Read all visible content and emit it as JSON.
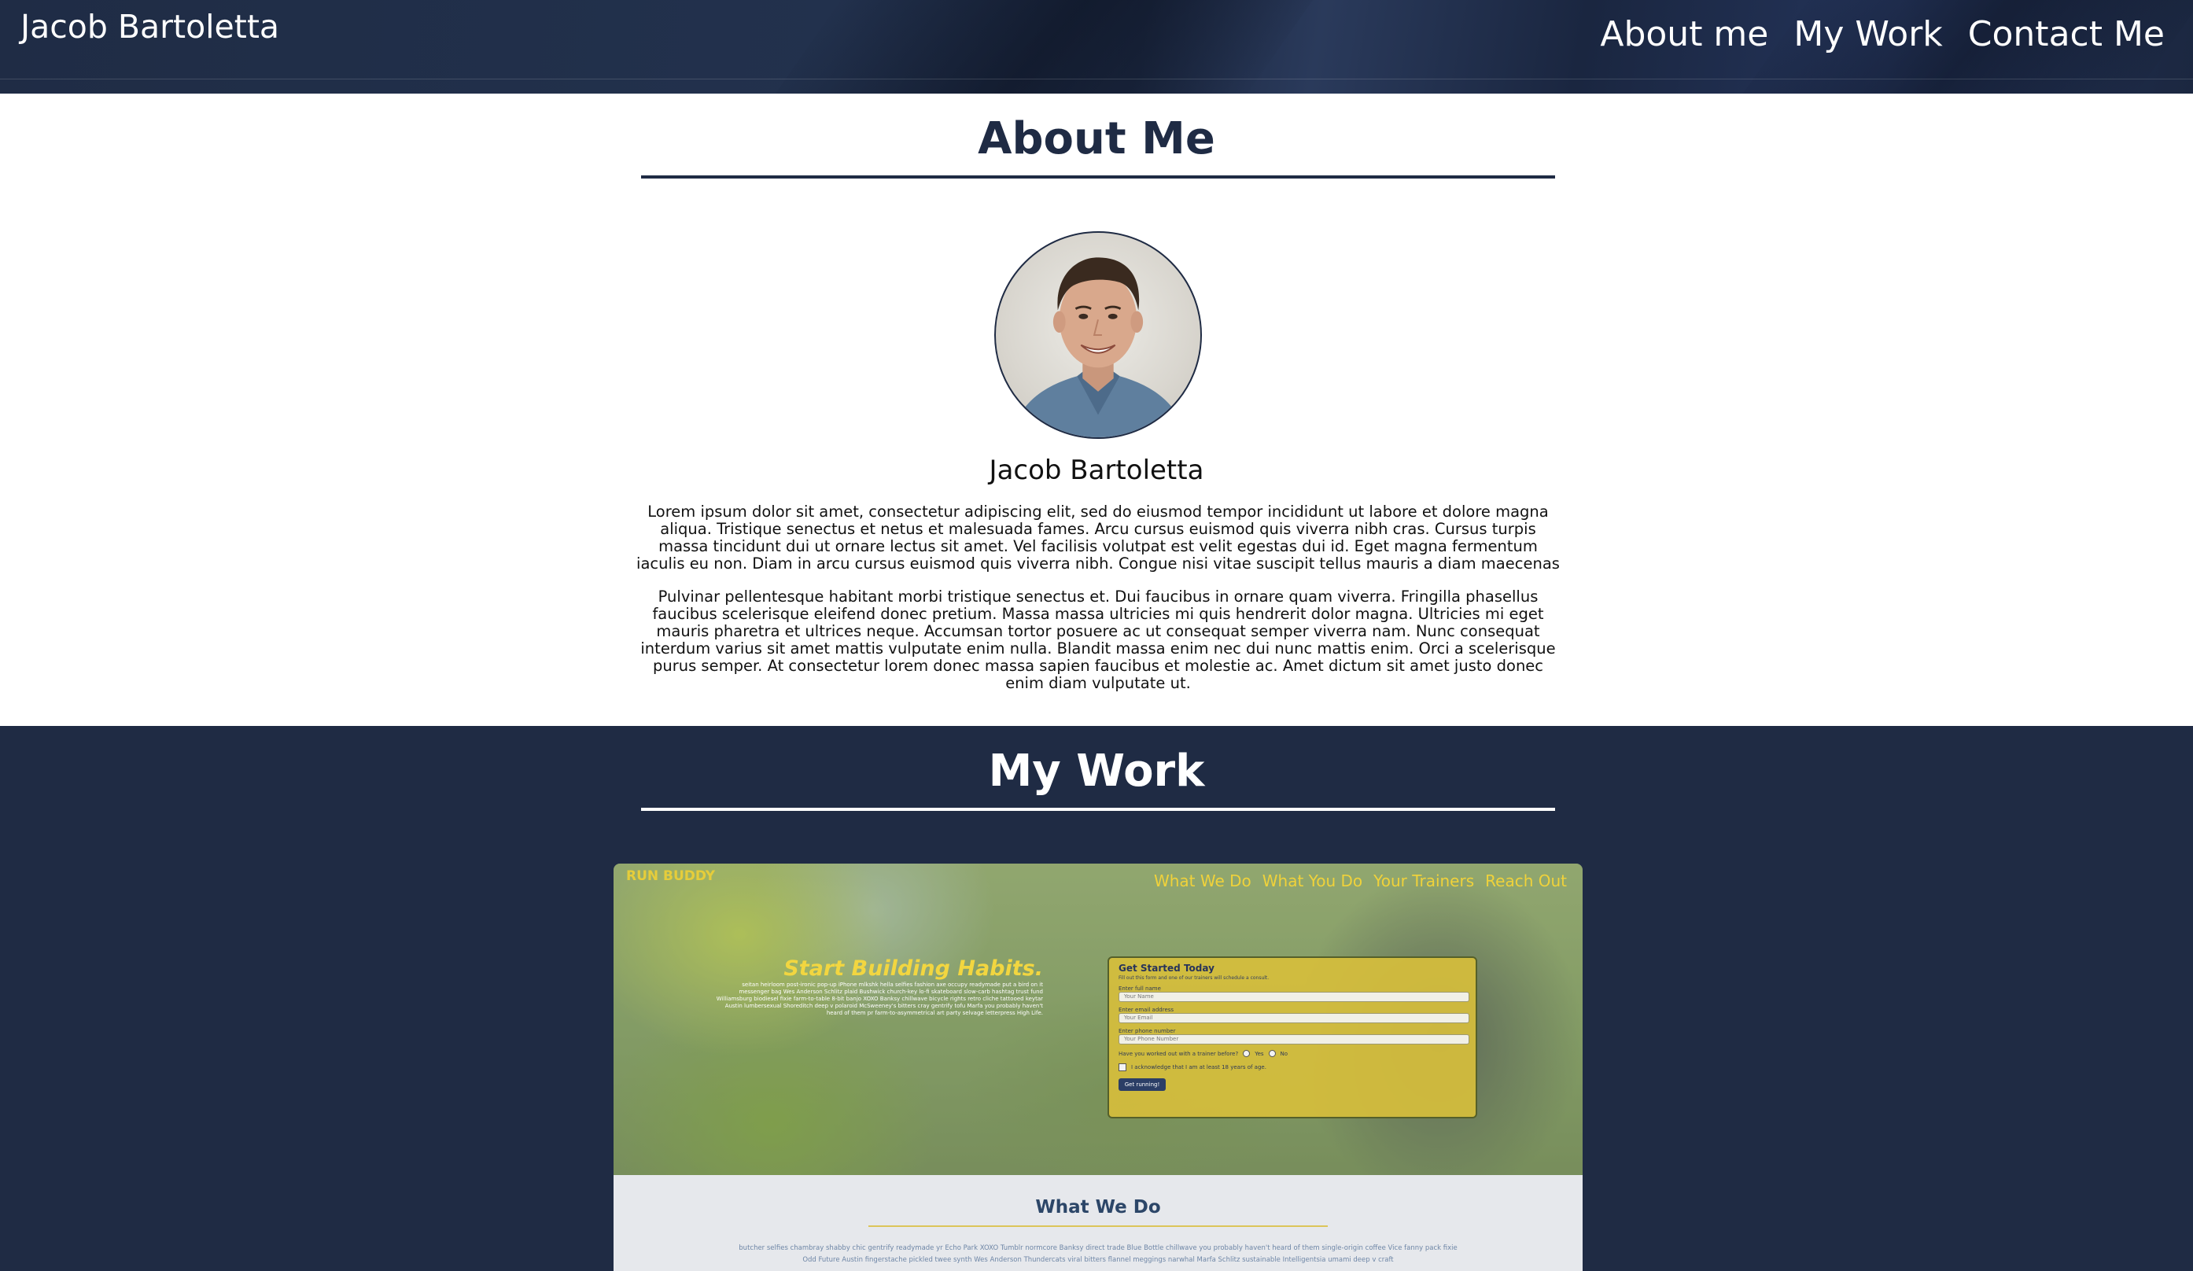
{
  "header": {
    "brand": "Jacob Bartoletta",
    "nav": [
      "About me",
      "My Work",
      "Contact Me"
    ]
  },
  "about": {
    "title": "About Me",
    "name": "Jacob Bartoletta",
    "paragraphs": [
      "Lorem ipsum dolor sit amet, consectetur adipiscing elit, sed do eiusmod tempor incididunt ut labore et dolore magna aliqua. Tristique senectus et netus et malesuada fames. Arcu cursus euismod quis viverra nibh cras. Cursus turpis massa tincidunt dui ut ornare lectus sit amet. Vel facilisis volutpat est velit egestas dui id. Eget magna fermentum iaculis eu non. Diam in arcu cursus euismod quis viverra nibh. Congue nisi vitae suscipit tellus mauris a diam maecenas",
      "Pulvinar pellentesque habitant morbi tristique senectus et. Dui faucibus in ornare quam viverra. Fringilla phasellus faucibus scelerisque eleifend donec pretium. Massa massa ultricies mi quis hendrerit dolor magna. Ultricies mi eget mauris pharetra et ultrices neque. Accumsan tortor posuere ac ut consequat semper viverra nam. Nunc consequat interdum varius sit amet mattis vulputate enim nulla. Blandit massa enim nec dui nunc mattis enim. Orci a scelerisque purus semper. At consectetur lorem donec massa sapien faucibus et molestie ac. Amet dictum sit amet justo donec enim diam vulputate ut."
    ]
  },
  "work": {
    "title": "My Work",
    "project": {
      "logo": "RUN BUDDY",
      "nav": [
        "What We Do",
        "What You Do",
        "Your Trainers",
        "Reach Out"
      ],
      "headline": "Start Building Habits.",
      "copy": "seitan heirloom post-ironic pop-up iPhone mlkshk hella selfies fashion axe occupy readymade put a bird on it messenger bag Wes Anderson Schlitz plaid Bushwick church-key lo-fi skateboard slow-carb hashtag trust fund Williamsburg biodiesel fixie farm-to-table 8-bit banjo XOXO Banksy chillwave bicycle rights retro cliche tattooed keytar Austin lumbersexual Shoreditch deep v polaroid McSweeney's bitters cray gentrify tofu Marfa you probably haven't heard of them pr farm-to-asymmetrical art party selvage letterpress High Life.",
      "form": {
        "title": "Get Started Today",
        "subtitle": "Fill out this form and one of our trainers will schedule a consult.",
        "fields": [
          {
            "label": "Enter full name",
            "placeholder": "Your Name"
          },
          {
            "label": "Enter email address",
            "placeholder": "Your Email"
          },
          {
            "label": "Enter phone number",
            "placeholder": "Your Phone Number"
          }
        ],
        "radio_question": "Have you worked out with a trainer before?",
        "radio_yes": "Yes",
        "radio_no": "No",
        "checkbox_label": "I acknowledge that I am at least 18 years of age.",
        "button": "Get running!"
      },
      "section_title": "What We Do",
      "section_copy": "butcher selfies chambray shabby chic gentrify readymade yr Echo Park XOXO Tumblr normcore Banksy direct trade Blue Bottle chillwave you probably haven't heard of them single-origin coffee Vice fanny pack fixie Odd Future Austin fingerstache pickled twee synth Wes Anderson Thundercats viral bitters flannel meggings narwhal Marfa Schlitz sustainable Intelligentsia umami deep v craft"
    }
  }
}
